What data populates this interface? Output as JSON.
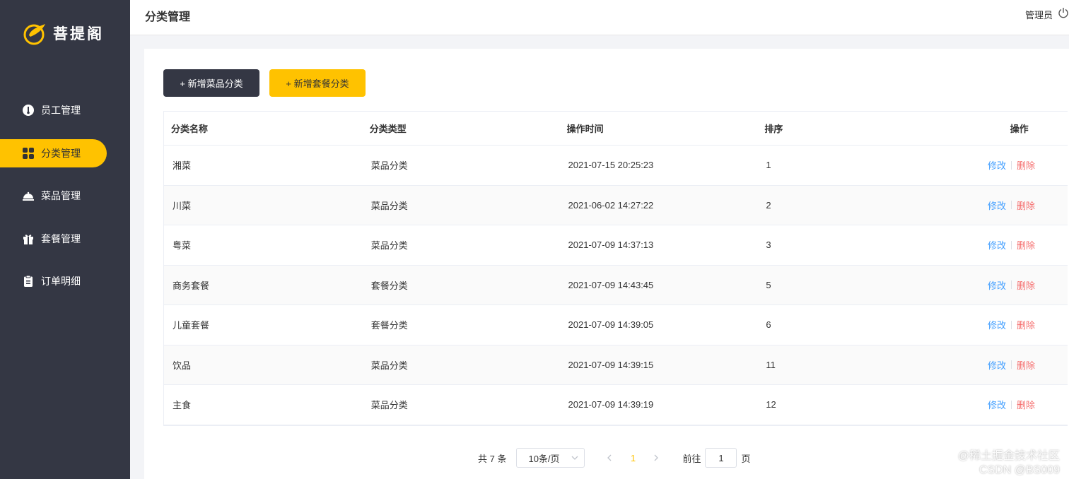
{
  "brand": {
    "name": "菩提阁"
  },
  "sidebar": {
    "items": [
      {
        "label": "员工管理",
        "icon": "employee-icon",
        "active": false
      },
      {
        "label": "分类管理",
        "icon": "category-icon",
        "active": true
      },
      {
        "label": "菜品管理",
        "icon": "dish-icon",
        "active": false
      },
      {
        "label": "套餐管理",
        "icon": "combo-gift-icon",
        "active": false
      },
      {
        "label": "订单明细",
        "icon": "order-clipboard-icon",
        "active": false
      }
    ]
  },
  "header": {
    "title": "分类管理",
    "user": "管理员"
  },
  "toolbar": {
    "add_dish_category": "+ 新增菜品分类",
    "add_combo_category": "+ 新增套餐分类"
  },
  "table": {
    "columns": [
      "分类名称",
      "分类类型",
      "操作时间",
      "排序",
      "操作"
    ],
    "rows": [
      {
        "name": "湘菜",
        "type": "菜品分类",
        "time": "2021-07-15 20:25:23",
        "sort": "1"
      },
      {
        "name": "川菜",
        "type": "菜品分类",
        "time": "2021-06-02 14:27:22",
        "sort": "2"
      },
      {
        "name": "粤菜",
        "type": "菜品分类",
        "time": "2021-07-09 14:37:13",
        "sort": "3"
      },
      {
        "name": "商务套餐",
        "type": "套餐分类",
        "time": "2021-07-09 14:43:45",
        "sort": "5"
      },
      {
        "name": "儿童套餐",
        "type": "套餐分类",
        "time": "2021-07-09 14:39:05",
        "sort": "6"
      },
      {
        "name": "饮品",
        "type": "菜品分类",
        "time": "2021-07-09 14:39:15",
        "sort": "11"
      },
      {
        "name": "主食",
        "type": "菜品分类",
        "time": "2021-07-09 14:39:19",
        "sort": "12"
      }
    ],
    "edit_label": "修改",
    "delete_label": "删除"
  },
  "pagination": {
    "total_text": "共 7 条",
    "page_size": "10条/页",
    "current_page": "1",
    "goto_label": "前往",
    "goto_value": "1",
    "page_suffix": "页"
  },
  "watermark": {
    "line1": "@稀土掘金技术社区",
    "line2": "CSDN @BS009"
  },
  "colors": {
    "sidebar": "#343744",
    "accent": "#ffc200",
    "edit": "#419eff",
    "delete": "#f56c6c"
  }
}
